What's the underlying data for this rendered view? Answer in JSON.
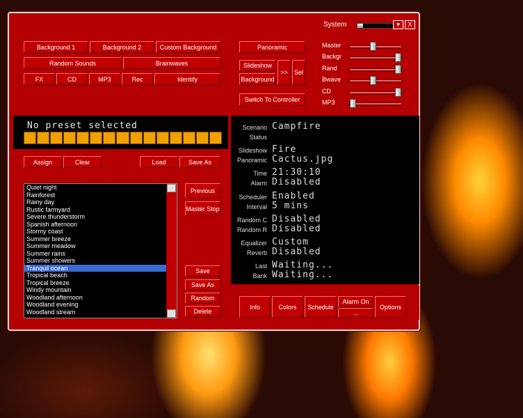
{
  "system": {
    "label": "System",
    "level": 0.15
  },
  "titlebar": {
    "dropdown_glyph": "▾",
    "close_glyph": "X"
  },
  "top_buttons": {
    "background1": "Background 1",
    "background2": "Background 2",
    "custom_background": "Custom Background",
    "random_sounds": "Random Sounds",
    "brainwaves": "Brainwaves",
    "fx": "FX",
    "cd": "CD",
    "mp3": "MP3",
    "rec": "Rec",
    "identify": "Identify"
  },
  "mid_buttons": {
    "panoramic": "Panoramic",
    "slideshow": "Slideshow",
    "background": "Background",
    "next": ">>",
    "sel": "Sel",
    "switch_controller": "Switch To Controller"
  },
  "sliders": [
    {
      "label": "Master",
      "value": 0.45
    },
    {
      "label": "Backgr",
      "value": 1.0
    },
    {
      "label": "Rand",
      "value": 1.0
    },
    {
      "label": "Bwave",
      "value": 0.45
    },
    {
      "label": "CD",
      "value": 1.0
    },
    {
      "label": "MP3",
      "value": 0.0
    }
  ],
  "preset": {
    "text": "No preset selected",
    "segments": 15
  },
  "preset_buttons": {
    "assign": "Assign",
    "clear": "Clear",
    "load": "Load",
    "save_as": "Save As"
  },
  "presets": {
    "items": [
      "Quiet night",
      "Rainforest",
      "Rainy day",
      "Rustic farmyard",
      "Severe thunderstorm",
      "Spanish afternoon",
      "Stormy coast",
      "Summer breeze",
      "Summer meadow",
      "Summer rains",
      "Summer showers",
      "Tranquil ocean",
      "Tropical beach",
      "Tropical breeze",
      "Windy mountain",
      "Woodland afternoon",
      "Woodland evening",
      "Woodland stream"
    ],
    "selected": "Tranquil ocean"
  },
  "list_buttons": {
    "previous": "Previous",
    "master_stop": "Master Stop",
    "save": "Save",
    "save_as": "Save As",
    "random": "Random",
    "delete": "Delete"
  },
  "status": {
    "scenario": {
      "label": "Scenario",
      "value": "Campfire"
    },
    "status": {
      "label": "Status",
      "value": ""
    },
    "slideshow": {
      "label": "Slideshow",
      "value": "Fire"
    },
    "panoramic": {
      "label": "Panoramic",
      "value": "Cactus.jpg"
    },
    "time": {
      "label": "Time",
      "value": "21:30:10"
    },
    "alarm": {
      "label": "Alarm",
      "value": "Disabled"
    },
    "scheduler": {
      "label": "Scheduler",
      "value": "Enabled"
    },
    "interval": {
      "label": "Interval",
      "value": "5 mins"
    },
    "random_c": {
      "label": "Random C",
      "value": "Disabled"
    },
    "random_r": {
      "label": "Random R",
      "value": "Disabled"
    },
    "equalizer": {
      "label": "Equalizer",
      "value": "Custom"
    },
    "reverb": {
      "label": "Reverb",
      "value": "Disabled"
    },
    "last": {
      "label": "Last",
      "value": "Waiting..."
    },
    "bank": {
      "label": "Bank",
      "value": "Waiting..."
    }
  },
  "bottom_buttons": {
    "info": "Info",
    "colors": "Colors",
    "schedule": "Schedule",
    "alarm_on": "Alarm On",
    "alarm_more": "...",
    "options": "Options"
  }
}
